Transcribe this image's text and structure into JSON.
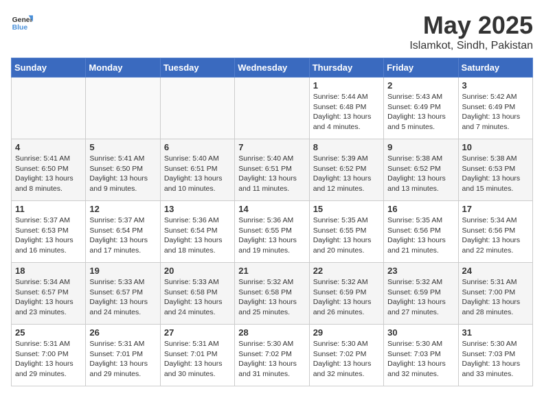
{
  "header": {
    "logo_general": "General",
    "logo_blue": "Blue",
    "title": "May 2025",
    "subtitle": "Islamkot, Sindh, Pakistan"
  },
  "days_of_week": [
    "Sunday",
    "Monday",
    "Tuesday",
    "Wednesday",
    "Thursday",
    "Friday",
    "Saturday"
  ],
  "weeks": [
    [
      {
        "day": "",
        "info": ""
      },
      {
        "day": "",
        "info": ""
      },
      {
        "day": "",
        "info": ""
      },
      {
        "day": "",
        "info": ""
      },
      {
        "day": "1",
        "info": "Sunrise: 5:44 AM\nSunset: 6:48 PM\nDaylight: 13 hours\nand 4 minutes."
      },
      {
        "day": "2",
        "info": "Sunrise: 5:43 AM\nSunset: 6:49 PM\nDaylight: 13 hours\nand 5 minutes."
      },
      {
        "day": "3",
        "info": "Sunrise: 5:42 AM\nSunset: 6:49 PM\nDaylight: 13 hours\nand 7 minutes."
      }
    ],
    [
      {
        "day": "4",
        "info": "Sunrise: 5:41 AM\nSunset: 6:50 PM\nDaylight: 13 hours\nand 8 minutes."
      },
      {
        "day": "5",
        "info": "Sunrise: 5:41 AM\nSunset: 6:50 PM\nDaylight: 13 hours\nand 9 minutes."
      },
      {
        "day": "6",
        "info": "Sunrise: 5:40 AM\nSunset: 6:51 PM\nDaylight: 13 hours\nand 10 minutes."
      },
      {
        "day": "7",
        "info": "Sunrise: 5:40 AM\nSunset: 6:51 PM\nDaylight: 13 hours\nand 11 minutes."
      },
      {
        "day": "8",
        "info": "Sunrise: 5:39 AM\nSunset: 6:52 PM\nDaylight: 13 hours\nand 12 minutes."
      },
      {
        "day": "9",
        "info": "Sunrise: 5:38 AM\nSunset: 6:52 PM\nDaylight: 13 hours\nand 13 minutes."
      },
      {
        "day": "10",
        "info": "Sunrise: 5:38 AM\nSunset: 6:53 PM\nDaylight: 13 hours\nand 15 minutes."
      }
    ],
    [
      {
        "day": "11",
        "info": "Sunrise: 5:37 AM\nSunset: 6:53 PM\nDaylight: 13 hours\nand 16 minutes."
      },
      {
        "day": "12",
        "info": "Sunrise: 5:37 AM\nSunset: 6:54 PM\nDaylight: 13 hours\nand 17 minutes."
      },
      {
        "day": "13",
        "info": "Sunrise: 5:36 AM\nSunset: 6:54 PM\nDaylight: 13 hours\nand 18 minutes."
      },
      {
        "day": "14",
        "info": "Sunrise: 5:36 AM\nSunset: 6:55 PM\nDaylight: 13 hours\nand 19 minutes."
      },
      {
        "day": "15",
        "info": "Sunrise: 5:35 AM\nSunset: 6:55 PM\nDaylight: 13 hours\nand 20 minutes."
      },
      {
        "day": "16",
        "info": "Sunrise: 5:35 AM\nSunset: 6:56 PM\nDaylight: 13 hours\nand 21 minutes."
      },
      {
        "day": "17",
        "info": "Sunrise: 5:34 AM\nSunset: 6:56 PM\nDaylight: 13 hours\nand 22 minutes."
      }
    ],
    [
      {
        "day": "18",
        "info": "Sunrise: 5:34 AM\nSunset: 6:57 PM\nDaylight: 13 hours\nand 23 minutes."
      },
      {
        "day": "19",
        "info": "Sunrise: 5:33 AM\nSunset: 6:57 PM\nDaylight: 13 hours\nand 24 minutes."
      },
      {
        "day": "20",
        "info": "Sunrise: 5:33 AM\nSunset: 6:58 PM\nDaylight: 13 hours\nand 24 minutes."
      },
      {
        "day": "21",
        "info": "Sunrise: 5:32 AM\nSunset: 6:58 PM\nDaylight: 13 hours\nand 25 minutes."
      },
      {
        "day": "22",
        "info": "Sunrise: 5:32 AM\nSunset: 6:59 PM\nDaylight: 13 hours\nand 26 minutes."
      },
      {
        "day": "23",
        "info": "Sunrise: 5:32 AM\nSunset: 6:59 PM\nDaylight: 13 hours\nand 27 minutes."
      },
      {
        "day": "24",
        "info": "Sunrise: 5:31 AM\nSunset: 7:00 PM\nDaylight: 13 hours\nand 28 minutes."
      }
    ],
    [
      {
        "day": "25",
        "info": "Sunrise: 5:31 AM\nSunset: 7:00 PM\nDaylight: 13 hours\nand 29 minutes."
      },
      {
        "day": "26",
        "info": "Sunrise: 5:31 AM\nSunset: 7:01 PM\nDaylight: 13 hours\nand 29 minutes."
      },
      {
        "day": "27",
        "info": "Sunrise: 5:31 AM\nSunset: 7:01 PM\nDaylight: 13 hours\nand 30 minutes."
      },
      {
        "day": "28",
        "info": "Sunrise: 5:30 AM\nSunset: 7:02 PM\nDaylight: 13 hours\nand 31 minutes."
      },
      {
        "day": "29",
        "info": "Sunrise: 5:30 AM\nSunset: 7:02 PM\nDaylight: 13 hours\nand 32 minutes."
      },
      {
        "day": "30",
        "info": "Sunrise: 5:30 AM\nSunset: 7:03 PM\nDaylight: 13 hours\nand 32 minutes."
      },
      {
        "day": "31",
        "info": "Sunrise: 5:30 AM\nSunset: 7:03 PM\nDaylight: 13 hours\nand 33 minutes."
      }
    ]
  ]
}
